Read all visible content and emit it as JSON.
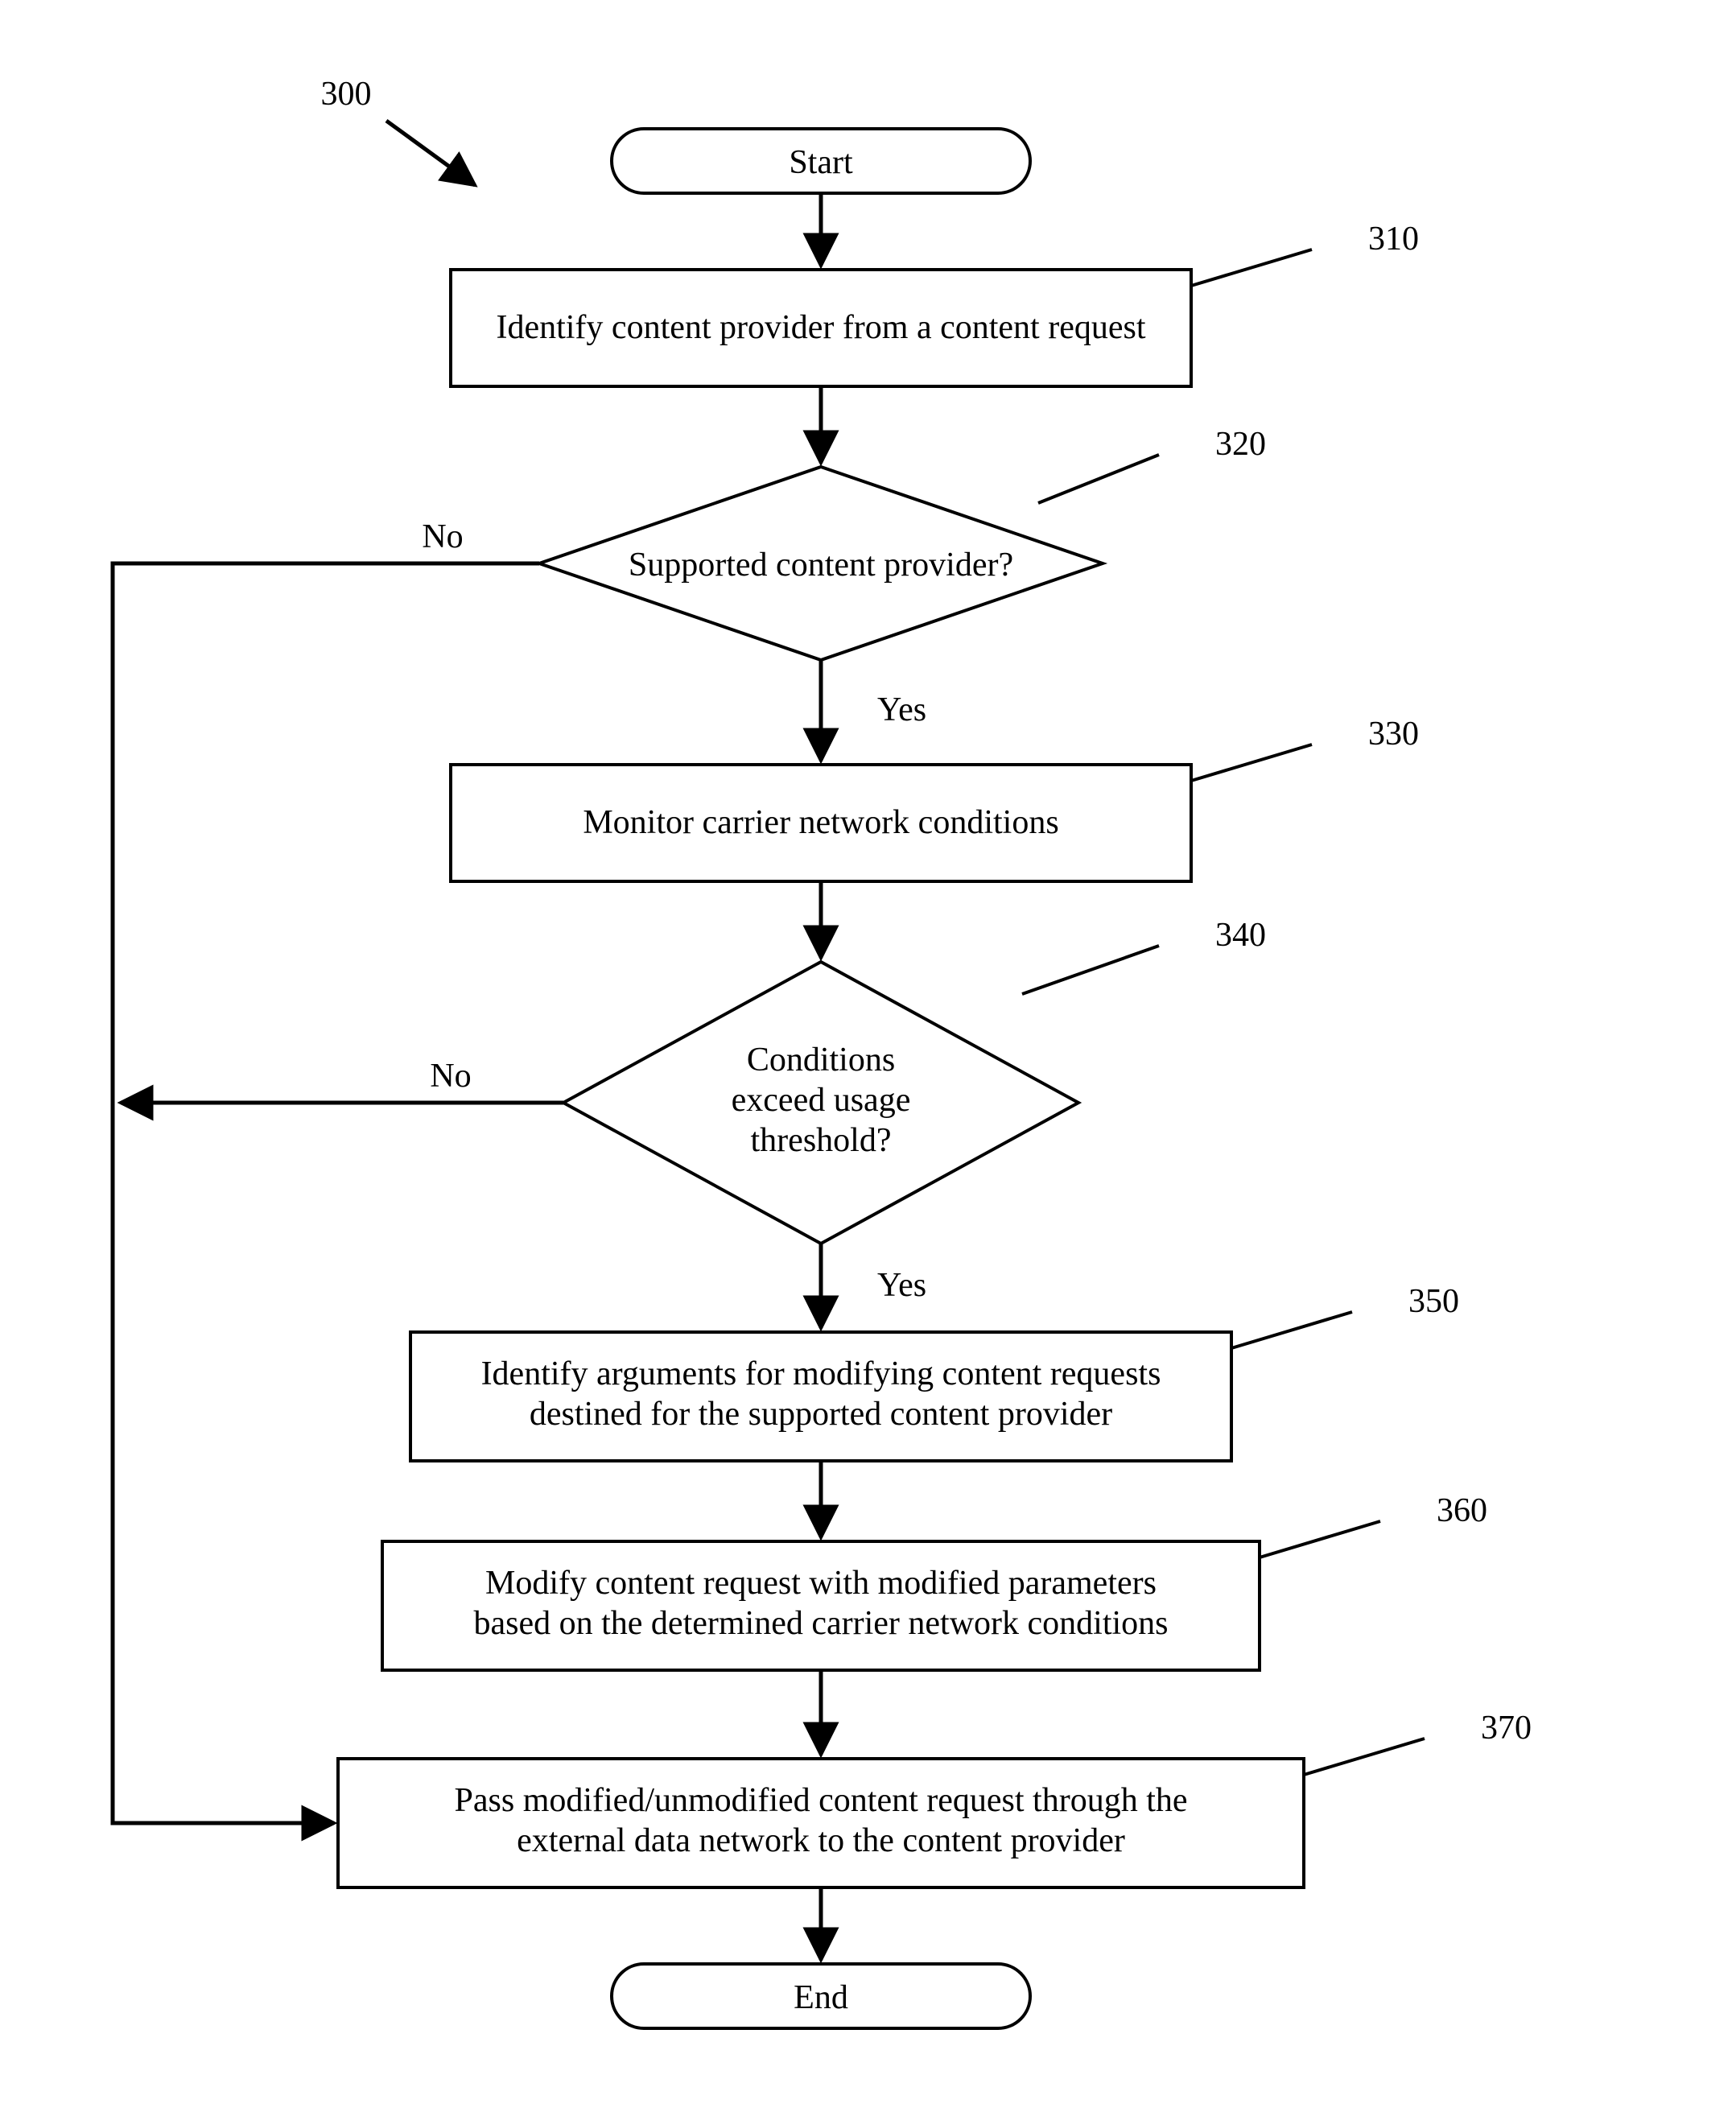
{
  "figure_ref": "300",
  "nodes": {
    "start": "Start",
    "end": "End",
    "n310": "Identify content provider from a content request",
    "n320": "Supported content provider?",
    "n330": "Monitor carrier network conditions",
    "n340_l1": "Conditions",
    "n340_l2": "exceed usage",
    "n340_l3": "threshold?",
    "n350_l1": "Identify arguments for modifying content requests",
    "n350_l2": "destined for the supported content provider",
    "n360_l1": "Modify content request with modified parameters",
    "n360_l2": "based on the determined carrier network conditions",
    "n370_l1": "Pass modified/unmodified content request through the",
    "n370_l2": "external data network to the content provider"
  },
  "refs": {
    "r310": "310",
    "r320": "320",
    "r330": "330",
    "r340": "340",
    "r350": "350",
    "r360": "360",
    "r370": "370"
  },
  "edges": {
    "yes": "Yes",
    "no": "No"
  }
}
